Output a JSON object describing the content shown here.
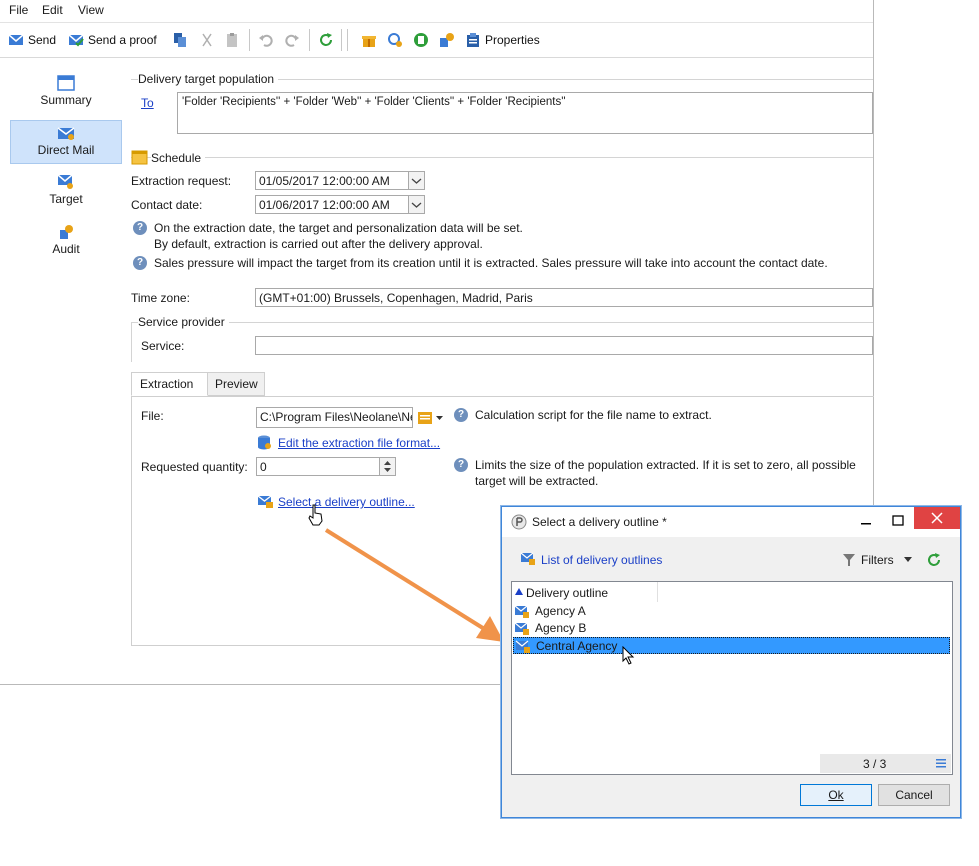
{
  "menu": [
    "File",
    "Edit",
    "View"
  ],
  "toolbar": {
    "send": "Send",
    "send_proof": "Send a proof",
    "properties": "Properties"
  },
  "nav": {
    "summary": "Summary",
    "direct_mail": "Direct Mail",
    "target": "Target",
    "audit": "Audit"
  },
  "target_population": {
    "title": "Delivery target population",
    "to_link": "To",
    "to_value": "'Folder 'Recipients'' + 'Folder 'Web'' + 'Folder 'Clients'' + 'Folder 'Recipients''"
  },
  "schedule": {
    "title": "Schedule",
    "extraction_label": "Extraction request:",
    "extraction_value": "01/05/2017 12:00:00 AM",
    "contact_label": "Contact date:",
    "contact_value": "01/06/2017 12:00:00 AM",
    "info1_line1": "On the extraction date, the target and personalization data will be set.",
    "info1_line2": "By default, extraction is carried out after the delivery approval.",
    "info2": "Sales pressure will impact the target from its creation until it is extracted. Sales pressure will take into account the contact date."
  },
  "timezone": {
    "label": "Time zone:",
    "value": "(GMT+01:00) Brussels, Copenhagen, Madrid, Paris"
  },
  "service_provider": {
    "title": "Service provider",
    "label": "Service:",
    "value": ""
  },
  "tabs": [
    "Extraction",
    "Preview"
  ],
  "extraction": {
    "file_label": "File:",
    "file_value": "C:\\Program Files\\Neolane\\Ne",
    "file_info": "Calculation script for the file name to extract.",
    "edit_format_link": "Edit the extraction file format...",
    "qty_label": "Requested quantity:",
    "qty_value": "0",
    "qty_info_line1": "Limits the size of the population extracted. If it is set to zero, all possible",
    "qty_info_line2": "target will be extracted.",
    "select_outline_link": "Select a delivery outline..."
  },
  "dialog": {
    "title": "Select a delivery outline *",
    "list_link": "List of delivery outlines",
    "filters": "Filters",
    "column": "Delivery outline",
    "rows": [
      "Agency A",
      "Agency B",
      "Central Agency"
    ],
    "selected_index": 2,
    "counter": "3 / 3",
    "ok": "Ok",
    "cancel": "Cancel"
  },
  "colors": {
    "selection": "#3399ff",
    "link": "#1a3fc7",
    "arrow": "#f0934a",
    "nav_selected": "#cfe3fb"
  }
}
